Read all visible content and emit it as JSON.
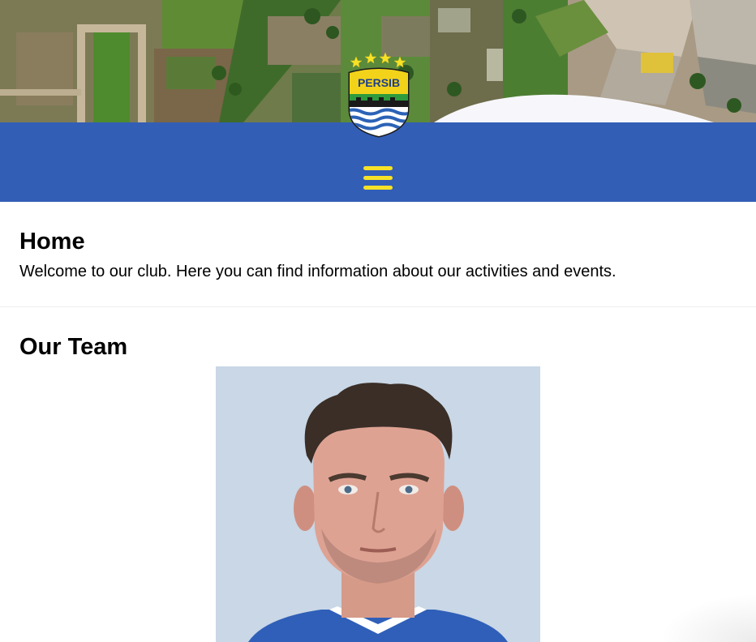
{
  "colors": {
    "nav_background": "#335eb6",
    "accent": "#f7e227",
    "logo_shield": "#f2d31a",
    "logo_green": "#2e9b3e",
    "logo_water": "#2b62b6"
  },
  "header": {
    "logo_text": "PERSIB",
    "logo_stars": 4,
    "menu_icon": "hamburger-menu-icon"
  },
  "home": {
    "title": "Home",
    "text": "Welcome to our club. Here you can find information about our activities and events."
  },
  "team": {
    "title": "Our Team"
  }
}
